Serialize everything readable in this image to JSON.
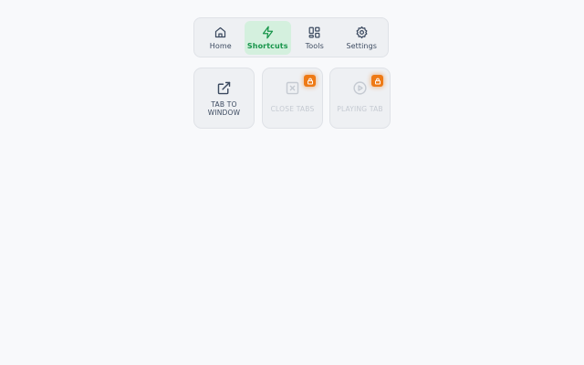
{
  "nav": {
    "tabs": [
      {
        "label": "Home",
        "icon": "home-icon",
        "active": false
      },
      {
        "label": "Shortcuts",
        "icon": "lightning-icon",
        "active": true
      },
      {
        "label": "Tools",
        "icon": "grid-icon",
        "active": false
      },
      {
        "label": "Settings",
        "icon": "gear-icon",
        "active": false
      }
    ]
  },
  "shortcuts": [
    {
      "label": "TAB TO WINDOW",
      "icon": "external-link-icon",
      "locked": false
    },
    {
      "label": "CLOSE TABS",
      "icon": "close-box-icon",
      "locked": true
    },
    {
      "label": "PLAYING TAB",
      "icon": "play-circle-icon",
      "locked": true
    }
  ],
  "colors": {
    "accent": "#17954a",
    "accent_bg": "#d4f0de",
    "lock_badge": "#ee7a16",
    "text": "#3c4a60",
    "disabled_text": "#c5cad2"
  }
}
